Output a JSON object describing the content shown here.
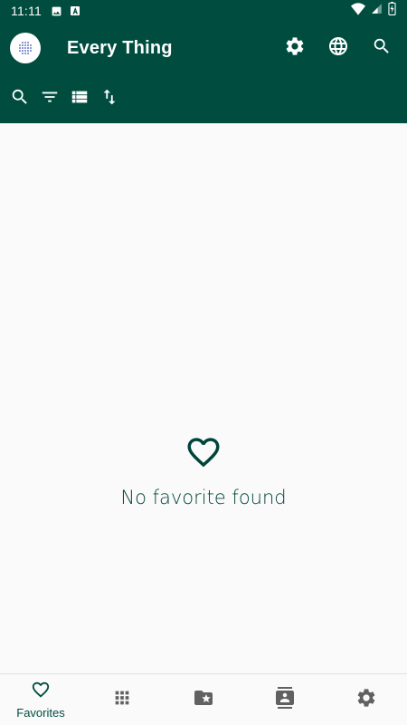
{
  "status_bar": {
    "time": "11:11",
    "icons": [
      "image-icon",
      "font-icon",
      "wifi-icon",
      "signal-icon",
      "battery-icon"
    ]
  },
  "app_bar": {
    "title": "Every Thing",
    "actions": [
      "settings-icon",
      "globe-icon",
      "search-icon"
    ]
  },
  "toolbar": {
    "actions": [
      "search-icon",
      "filter-icon",
      "list-view-icon",
      "sort-icon"
    ]
  },
  "empty_state": {
    "icon": "heart-outline-icon",
    "message": "No favorite found"
  },
  "bottom_nav": {
    "items": [
      {
        "icon": "heart-outline-icon",
        "label": "Favorites",
        "active": true
      },
      {
        "icon": "apps-grid-icon",
        "label": ""
      },
      {
        "icon": "folder-star-icon",
        "label": ""
      },
      {
        "icon": "contacts-icon",
        "label": ""
      },
      {
        "icon": "settings-icon",
        "label": ""
      }
    ]
  },
  "colors": {
    "primary": "#004d40",
    "background": "#fafafa",
    "inactive_icon": "#616161"
  }
}
